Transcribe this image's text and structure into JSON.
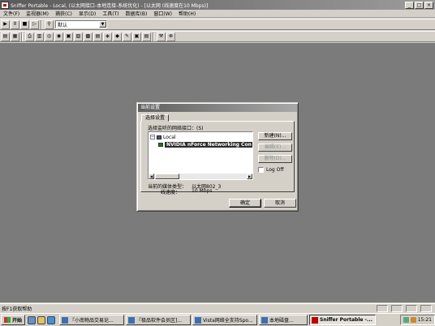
{
  "window": {
    "title": "Sniffer Portable - Local, (以太网接口-本地连接-系统优化) - [以太网 (线速度在10 Mbps)]",
    "controls": [
      "_",
      "□",
      "×"
    ]
  },
  "menu": [
    "文件(F)",
    "监视器(M)",
    "捕获(C)",
    "显示(D)",
    "工具(T)",
    "数据库(B)",
    "窗口(W)",
    "帮助(H)"
  ],
  "toolbar1": {
    "buttons": [
      "▶",
      "Ⅱ",
      "■",
      "▷",
      "⚲"
    ],
    "profile_value": "默认"
  },
  "toolbar2": {
    "buttons": [
      "▤",
      "▦",
      "⎙",
      "▥",
      "◎",
      "◉",
      "▣",
      "▧",
      "▩",
      "▤",
      "◈",
      "◆",
      "✎",
      "▣",
      "▤",
      "⚒",
      "⊗"
    ]
  },
  "dialog": {
    "title": "当前设置",
    "tab": "选择设置",
    "adapter_label": "选择监听的网络接口：(S)",
    "tree": {
      "root": "Local",
      "child": "NVIDIA nForce Networking Con"
    },
    "side_buttons": {
      "new": "新建(N)...",
      "edit": "编辑(E)...",
      "delete": "删除(D)..."
    },
    "logoff": "Log Off",
    "media_label": "当前的媒体类型：",
    "media_value": "以太网802_3",
    "speed_label": "线速度：",
    "speed_value": "10 Mbps",
    "ok": "确定",
    "cancel": "取消"
  },
  "status": {
    "text": "按F1获取帮助"
  },
  "taskbar": {
    "start": "开始",
    "tasks": [
      "『小南物品交易论...",
      "『极品软件会员区]...",
      "Vista网络全支持Spo...",
      "本地磁盘...",
      "Sniffer Portable -..."
    ],
    "clock": "15:21"
  }
}
